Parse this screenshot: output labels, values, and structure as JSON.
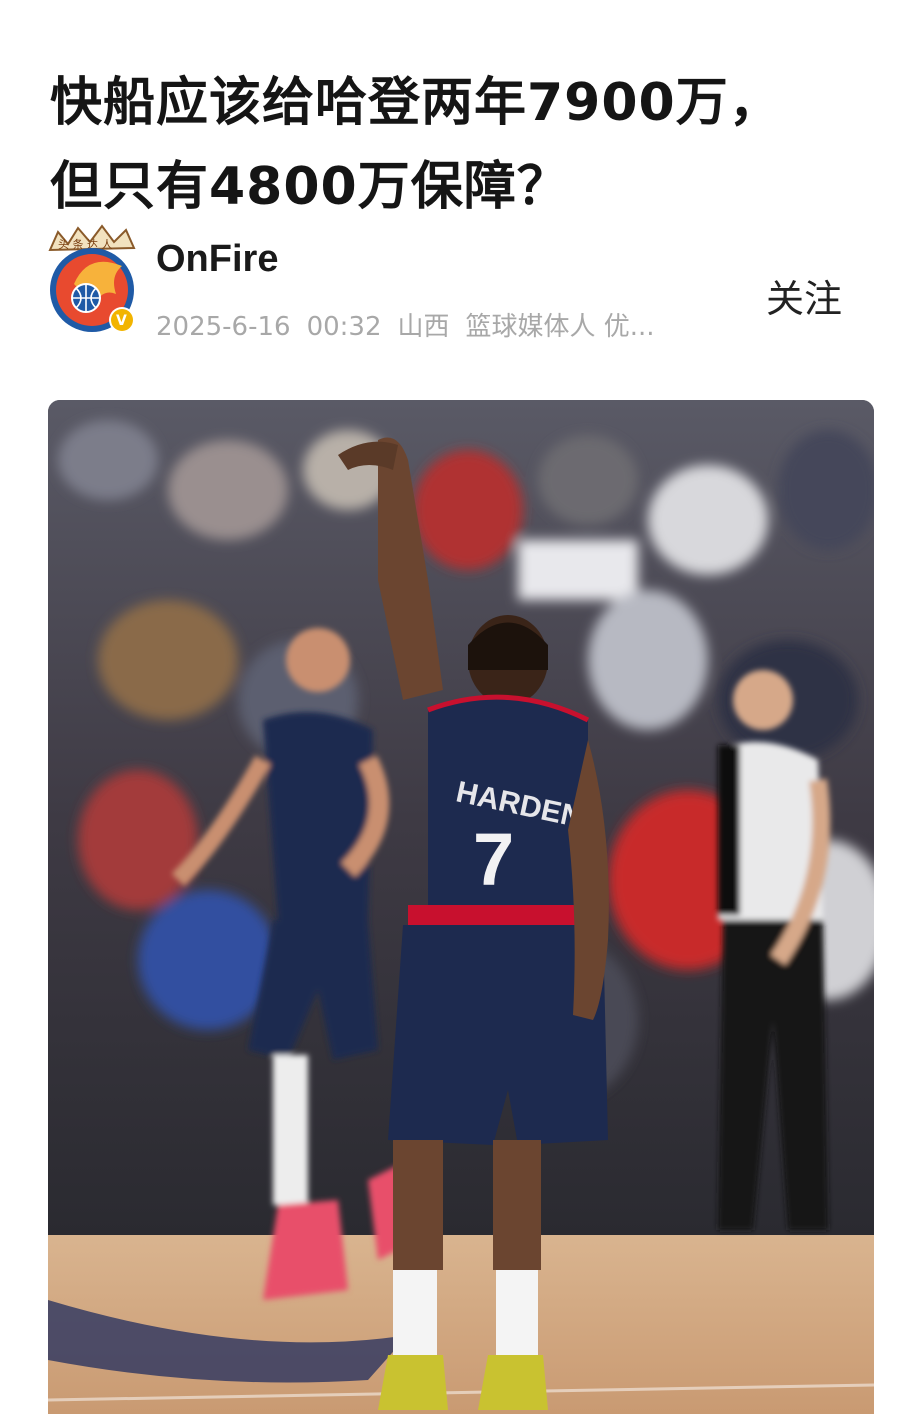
{
  "article": {
    "title_line1": "快船应该给哈登两年7900万，",
    "title_line2": "但只有4800万保障？"
  },
  "author": {
    "name": "OnFire",
    "avatar_badge_text": "头条达人",
    "verified_icon": "check-badge-icon",
    "date": "2025-6-16",
    "time": "00:32",
    "location": "山西",
    "description": "篮球媒体人 优...",
    "follow_label": "关注"
  },
  "photo": {
    "jersey_name": "HARDEN",
    "jersey_number": "7"
  },
  "colors": {
    "title": "#151515",
    "meta": "#a8a8a8",
    "jersey_navy": "#1d2a4f",
    "jersey_red": "#c8102e",
    "verified": "#f2b400"
  }
}
